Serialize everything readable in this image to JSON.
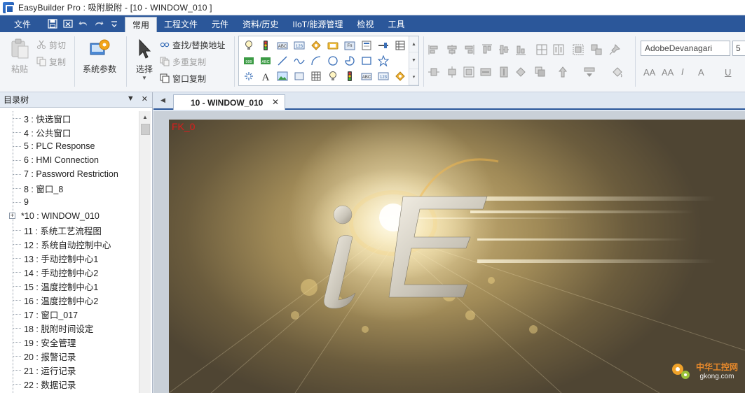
{
  "window": {
    "title": "EasyBuilder Pro : 吸附脱附 - [10 - WINDOW_010 ]"
  },
  "menu": {
    "items": [
      "文件",
      "常用",
      "工程文件",
      "元件",
      "资料/历史",
      "IIoT/能源管理",
      "检视",
      "工具"
    ],
    "active": "常用"
  },
  "ribbon": {
    "paste_label": "粘贴",
    "cut_label": "剪切",
    "copy_label": "复制",
    "system_params_label": "系统参数",
    "select_label": "选择",
    "find_replace_label": "查找/替换地址",
    "multi_copy_label": "多重复制",
    "window_copy_label": "窗口复制",
    "font_name": "AdobeDevanagari",
    "font_size": "5"
  },
  "left_pane": {
    "title": "目录树",
    "tree": [
      {
        "label": "3 : 快选窗口",
        "expander": false
      },
      {
        "label": "4 : 公共窗口",
        "expander": false
      },
      {
        "label": "5 : PLC Response",
        "expander": false
      },
      {
        "label": "6 : HMI Connection",
        "expander": false
      },
      {
        "label": "7 : Password Restriction",
        "expander": false
      },
      {
        "label": "8 : 窗口_8",
        "expander": false
      },
      {
        "label": "9",
        "expander": false
      },
      {
        "label": "*10 : WINDOW_010",
        "expander": true
      },
      {
        "label": "11 : 系统工艺流程图",
        "expander": false
      },
      {
        "label": "12 : 系统自动控制中心",
        "expander": false
      },
      {
        "label": "13 : 手动控制中心1",
        "expander": false
      },
      {
        "label": "14 : 手动控制中心2",
        "expander": false
      },
      {
        "label": "15 : 温度控制中心1",
        "expander": false
      },
      {
        "label": "16 : 温度控制中心2",
        "expander": false
      },
      {
        "label": "17 : 窗口_017",
        "expander": false
      },
      {
        "label": "18 : 脱附时间设定",
        "expander": false
      },
      {
        "label": "19 : 安全管理",
        "expander": false
      },
      {
        "label": "20 : 报警记录",
        "expander": false
      },
      {
        "label": "21 : 运行记录",
        "expander": false
      },
      {
        "label": "22 : 数据记录",
        "expander": false
      }
    ]
  },
  "editor": {
    "tab_label": "10 - WINDOW_010",
    "canvas_label": "FK_0",
    "logo_i": "i",
    "logo_e": "E"
  },
  "watermark": {
    "cn": "中华工控网",
    "url": "gkong.com"
  },
  "colors": {
    "menubar": "#2b579a",
    "canvas_label": "#e01b1b",
    "ribbon_bg": "#f3f5f8"
  }
}
